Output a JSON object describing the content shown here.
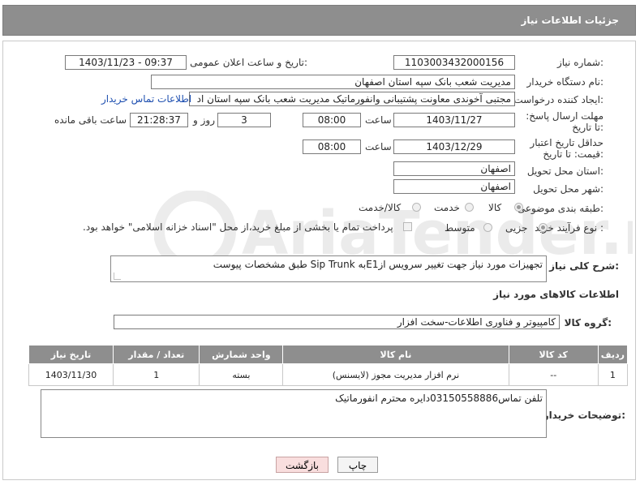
{
  "header": {
    "title": "جزئیات اطلاعات نیاز"
  },
  "labels": {
    "need_number": "شماره نیاز:",
    "announce_datetime": "تاریخ و ساعت اعلان عمومی:",
    "buyer_org": "نام دستگاه خریدار:",
    "requester": "ایجاد کننده درخواست:",
    "reply_deadline": "مهلت ارسال پاسخ: تا تاریخ:",
    "time_word": "ساعت",
    "day_and": "روز و",
    "remaining": "ساعت باقی مانده",
    "price_validity": "حداقل تاریخ اعتبار قیمت: تا تاریخ:",
    "delivery_province": "استان محل تحویل:",
    "delivery_city": "شهر محل تحویل:",
    "category": "طبقه بندی موضوعی:",
    "purchase_type": "نوع فرآیند خرید :",
    "description": "شرح کلی نیاز:",
    "goods_info": "اطلاعات کالاهای مورد نیاز",
    "goods_group": "گروه کالا:",
    "buyer_notes": "توضیحات خریدار:"
  },
  "fields": {
    "need_number": "1103003432000156",
    "announce_datetime": "1403/11/23 - 09:37",
    "buyer_org": "مدیریت شعب بانک سپه استان اصفهان",
    "requester": "مجتبی آخوندی معاونت پشتیبانی وانفورماتیک مدیریت شعب بانک سپه استان اد",
    "reply_date": "1403/11/27",
    "reply_time": "08:00",
    "reply_days": "3",
    "reply_remaining": "21:28:37",
    "validity_date": "1403/12/29",
    "validity_time": "08:00",
    "province": "اصفهان",
    "city": "اصفهان",
    "description": "تجهیزات مورد نیاز جهت تغییر سرویس ازE1به Sip Trunk طبق مشخصات پیوست",
    "goods_group": "کامپیوتر و فناوری اطلاعات-سخت افزار",
    "buyer_notes": "تلفن تماس03150558886دایره محترم انفورماتیک"
  },
  "links": {
    "buyer_contact": "اطلاعات تماس خریدار"
  },
  "category_options": [
    "کالا",
    "خدمت",
    "کالا/خدمت"
  ],
  "purchase_options": [
    "جزیی",
    "متوسط"
  ],
  "payment_note": "پرداخت تمام یا بخشی از مبلغ خرید،از محل \"اسناد خزانه اسلامی\" خواهد بود.",
  "table": {
    "headers": [
      "ردیف",
      "کد کالا",
      "نام کالا",
      "واحد شمارش",
      "تعداد / مقدار",
      "تاریخ نیاز"
    ],
    "rows": [
      [
        "1",
        "--",
        "نرم افزار مدیریت مجوز (لایسنس)",
        "بسته",
        "1",
        "1403/11/30"
      ]
    ]
  },
  "buttons": {
    "print": "چاپ",
    "back": "بازگشت"
  },
  "watermark": {
    "text": "AriaTender.net"
  },
  "colors": {
    "header_bg": "#8e8e8e",
    "link": "#1e4fb0",
    "back_btn": "#f9dede"
  }
}
